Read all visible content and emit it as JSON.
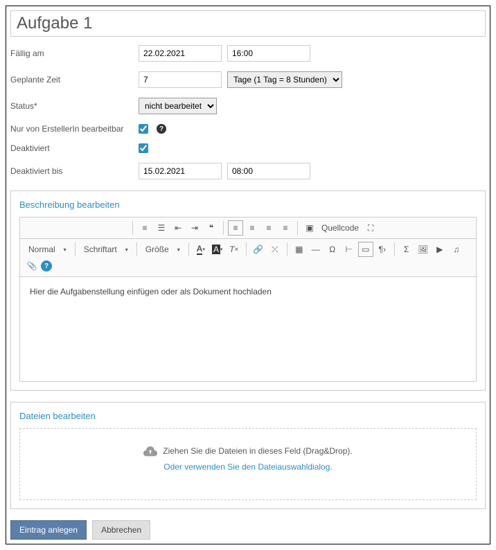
{
  "title": "Aufgabe 1",
  "fields": {
    "due_label": "Fällig am",
    "due_date": "22.02.2021",
    "due_time": "16:00",
    "planned_label": "Geplante Zeit",
    "planned_value": "7",
    "planned_unit": "Tage (1 Tag = 8 Stunden)",
    "status_label": "Status*",
    "status_value": "nicht bearbeitet",
    "owner_only_label": "Nur von ErstellerIn bearbeitbar",
    "deactivated_label": "Deaktiviert",
    "deactivated_until_label": "Deaktiviert bis",
    "deactivated_until_date": "15.02.2021",
    "deactivated_until_time": "08:00"
  },
  "description": {
    "section_title": "Beschreibung bearbeiten",
    "style_normal": "Normal",
    "font_label": "Schriftart",
    "size_label": "Größe",
    "source_label": "Quellcode",
    "content": "Hier die Aufgabenstellung einfügen oder als Dokument hochladen"
  },
  "files": {
    "section_title": "Dateien bearbeiten",
    "drop_text": "Ziehen Sie die Dateien in dieses Feld (Drag&Drop).",
    "dialog_text": "Oder verwenden Sie den Dateiauswahldialog."
  },
  "actions": {
    "submit": "Eintrag anlegen",
    "cancel": "Abbrechen"
  }
}
